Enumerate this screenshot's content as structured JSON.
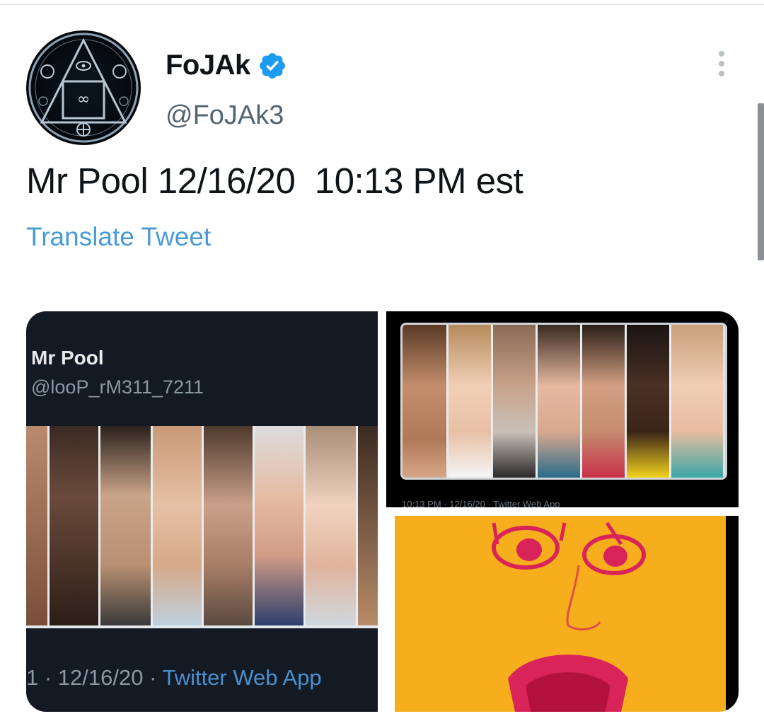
{
  "tweet": {
    "author": {
      "display_name": "FoJAk",
      "handle": "@FoJAk3",
      "verified": true,
      "avatar_icon": "occult-sigil-avatar"
    },
    "text": "Mr Pool 12/16/20  10:13 PM est",
    "translate_label": "Translate Tweet",
    "more_icon": "more-vertical-icon"
  },
  "media": {
    "left": {
      "embedded_name": "Mr Pool",
      "embedded_handle": "@looP_rM311_7211",
      "footer_prefix": "1 · 12/16/20 · ",
      "footer_app": "Twitter Web App"
    },
    "right_top": {
      "footer": "10:13 PM · 12/16/20 · Twitter Web App"
    }
  },
  "colors": {
    "link": "#4a9bd6",
    "verified": "#1d9bf0",
    "dark_tile": "#131a23",
    "yellow_tile": "#f6ae1d"
  }
}
